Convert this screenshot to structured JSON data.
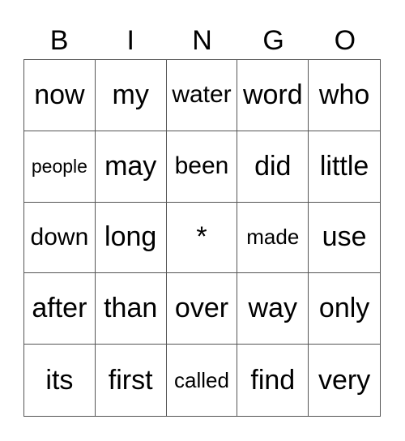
{
  "header": {
    "letters": [
      "B",
      "I",
      "N",
      "G",
      "O"
    ]
  },
  "card": {
    "rows": [
      [
        "now",
        "my",
        "water",
        "word",
        "who"
      ],
      [
        "people",
        "may",
        "been",
        "did",
        "little"
      ],
      [
        "down",
        "long",
        "*",
        "made",
        "use"
      ],
      [
        "after",
        "than",
        "over",
        "way",
        "only"
      ],
      [
        "its",
        "first",
        "called",
        "find",
        "very"
      ]
    ],
    "free_space": "*"
  }
}
